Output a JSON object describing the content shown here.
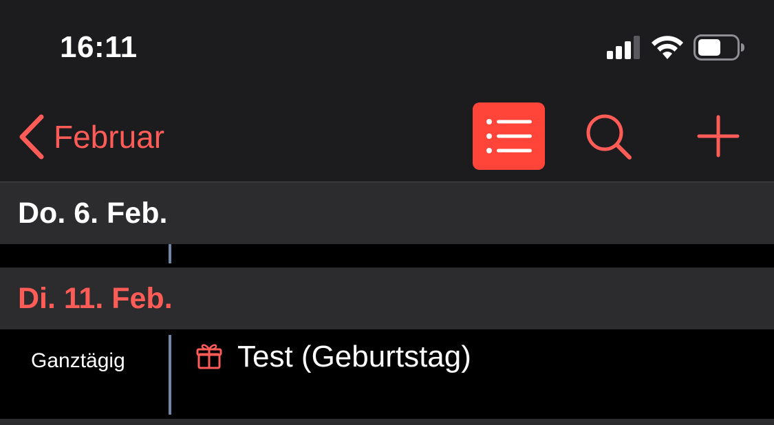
{
  "status_bar": {
    "time": "16:11",
    "icons": [
      "cellular-signal-icon",
      "wifi-icon",
      "battery-icon"
    ]
  },
  "nav": {
    "back_label": "Februar",
    "buttons": [
      "list-view-icon",
      "search-icon",
      "plus-icon"
    ],
    "accent_color": "#ff453a"
  },
  "days": [
    {
      "label": "Do. 6. Feb.",
      "is_today": false,
      "events": []
    },
    {
      "label": "Di. 11. Feb.",
      "is_today": true,
      "events": [
        {
          "time_label": "Ganztägig",
          "icon": "gift-icon",
          "title": "Test (Geburtstag)"
        }
      ]
    }
  ]
}
